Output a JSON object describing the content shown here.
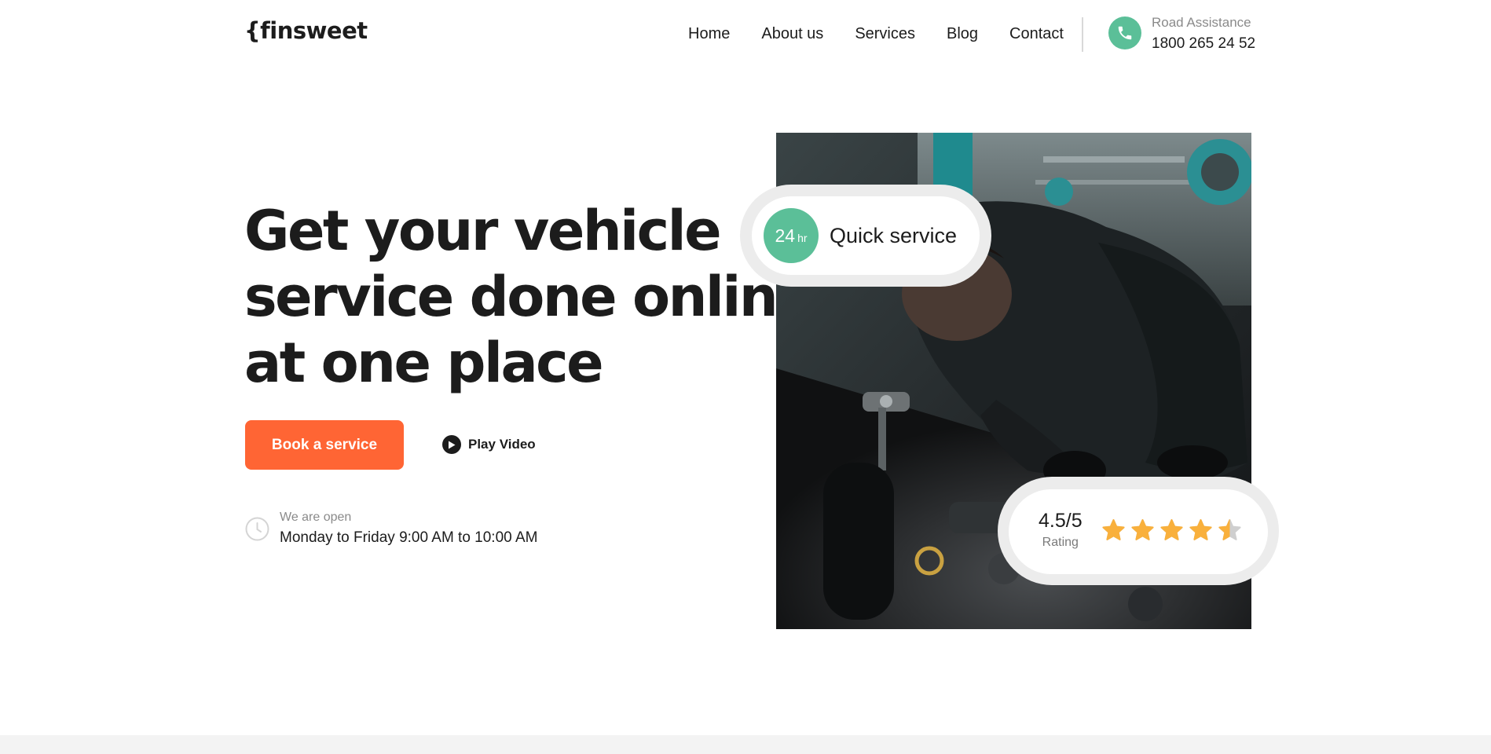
{
  "brand": {
    "logo_text": "{finsweet"
  },
  "nav": {
    "items": [
      {
        "label": "Home"
      },
      {
        "label": "About us"
      },
      {
        "label": "Services"
      },
      {
        "label": "Blog"
      },
      {
        "label": "Contact"
      }
    ]
  },
  "assistance": {
    "label": "Road Assistance",
    "phone": "1800 265 24 52",
    "icon": "phone-icon"
  },
  "hero": {
    "title_lines": [
      "Get your vehicle",
      "service done online",
      "at one place"
    ],
    "primary_button": "Book a service",
    "secondary_button": "Play Video",
    "hours_label": "We are open",
    "hours_value": "Monday to Friday 9:00 AM to 10:00 AM"
  },
  "quick_badge": {
    "number": "24",
    "unit": "hr",
    "text": "Quick service"
  },
  "rating_badge": {
    "value": "4.5/5",
    "label": "Rating",
    "stars_total": 5,
    "stars_filled": 4.5
  },
  "colors": {
    "accent_orange": "#ff6534",
    "accent_green": "#5bbf98",
    "star_yellow": "#f9b03c",
    "text_dark": "#1c1c1c"
  }
}
